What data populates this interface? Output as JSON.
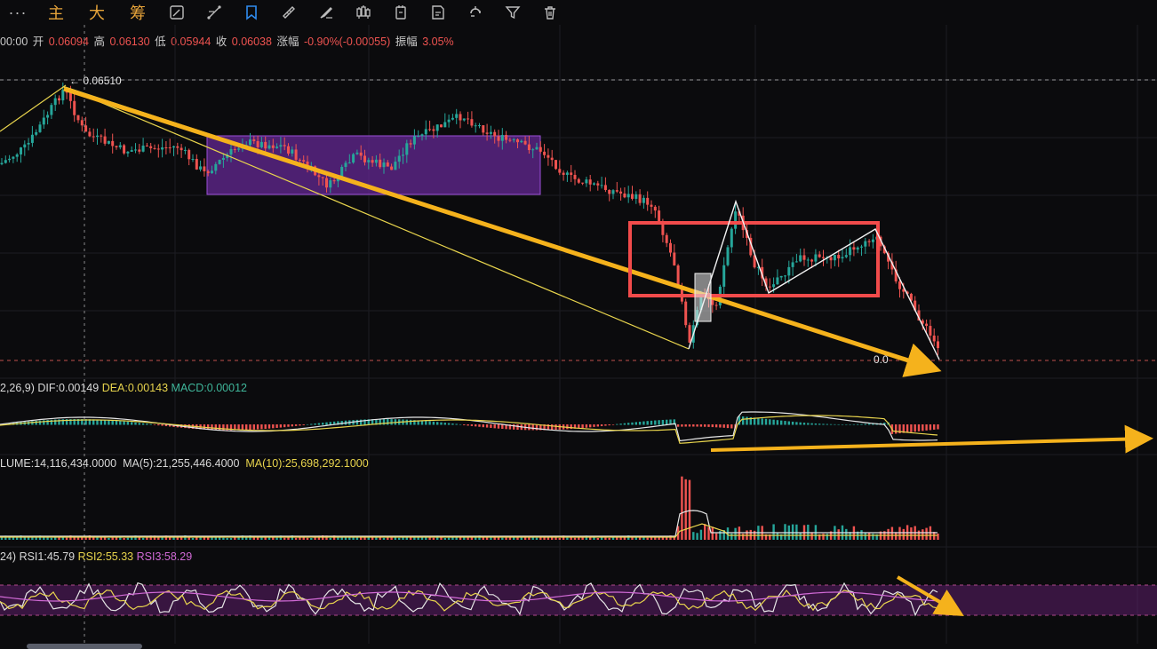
{
  "toolbar": {
    "more": "···",
    "text_buttons": [
      "主",
      "大",
      "筹"
    ],
    "icons": [
      "pencil-tool-icon",
      "line-tool-icon",
      "tag-icon",
      "ruler-icon",
      "brush-icon",
      "candlestick-icon",
      "measure-icon",
      "note-icon",
      "magnet-icon",
      "filter-icon",
      "delete-icon"
    ]
  },
  "ohlc": {
    "time": "00:00",
    "open_label": "开",
    "open": "0.06094",
    "high_label": "高",
    "high": "0.06130",
    "low_label": "低",
    "low": "0.05944",
    "close_label": "收",
    "close": "0.06038",
    "change_label": "涨幅",
    "change": "-0.90%(-0.00055)",
    "amp_label": "振幅",
    "amp": "3.05%"
  },
  "price_labels": {
    "peak": "← 0.06510",
    "current": "0.0"
  },
  "macd": {
    "params": "2,26,9)",
    "dif": "DIF:0.00149",
    "dea": "DEA:0.00143",
    "macd": "MACD:0.00012"
  },
  "volume": {
    "label": "LUME:14,116,434.0000",
    "ma5": "MA(5):21,255,446.4000",
    "ma10": "MA(10):25,698,292.1000"
  },
  "rsi": {
    "params": "24)",
    "rsi1": "RSI1:45.79",
    "rsi2": "RSI2:55.33",
    "rsi3": "RSI3:58.29"
  },
  "colors": {
    "up": "#ef5350",
    "down": "#26a69a",
    "accent": "#e8a53a",
    "arrow": "#f5b21c",
    "purple_zone": "#6a2a9c",
    "red_box": "#f24b4b"
  }
}
